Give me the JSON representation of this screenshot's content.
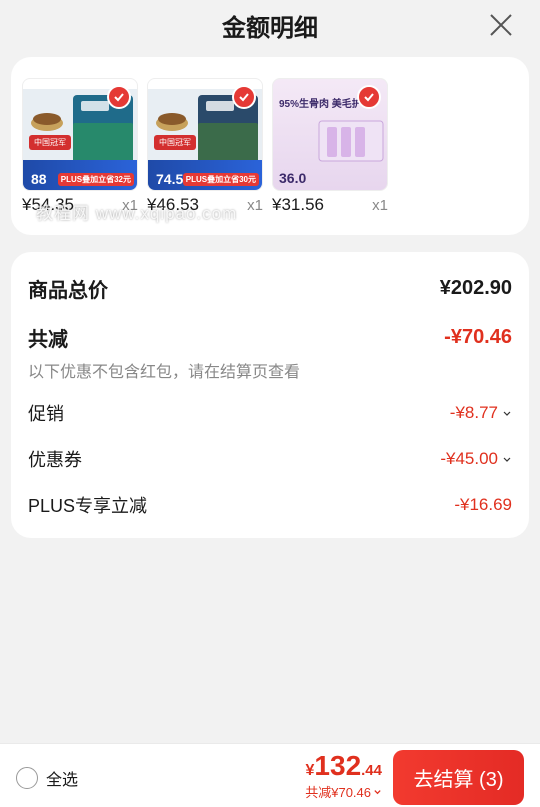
{
  "header": {
    "title": "金额明细"
  },
  "products": [
    {
      "price": "¥54.35",
      "qty": "x1",
      "promo_price": "88",
      "promo_tag": "PLUS叠加立省32元",
      "badge": "中国冠军"
    },
    {
      "price": "¥46.53",
      "qty": "x1",
      "promo_price": "74.5",
      "promo_tag": "PLUS叠加立省30元",
      "badge": "中国冠军"
    },
    {
      "price": "¥31.56",
      "qty": "x1",
      "promo_price": "36.0",
      "headline": "95%生骨肉 美毛护"
    }
  ],
  "watermark": "教程网 www.xqipao.com",
  "summary": {
    "goods_total_label": "商品总价",
    "goods_total_value": "¥202.90",
    "reduction_label": "共减",
    "reduction_value": "-¥70.46",
    "note": "以下优惠不包含红包，请在结算页查看",
    "items": [
      {
        "label": "促销",
        "value": "-¥8.77"
      },
      {
        "label": "优惠券",
        "value": "-¥45.00"
      },
      {
        "label": "PLUS专享立减",
        "value": "-¥16.69"
      }
    ]
  },
  "bottom": {
    "select_all": "全选",
    "currency": "¥",
    "total_int": "132",
    "total_dec": ".44",
    "saved": "共减¥70.46",
    "checkout": "去结算 (3)"
  },
  "colors": {
    "accent": "#e0301e",
    "button": "#f23a2f"
  }
}
